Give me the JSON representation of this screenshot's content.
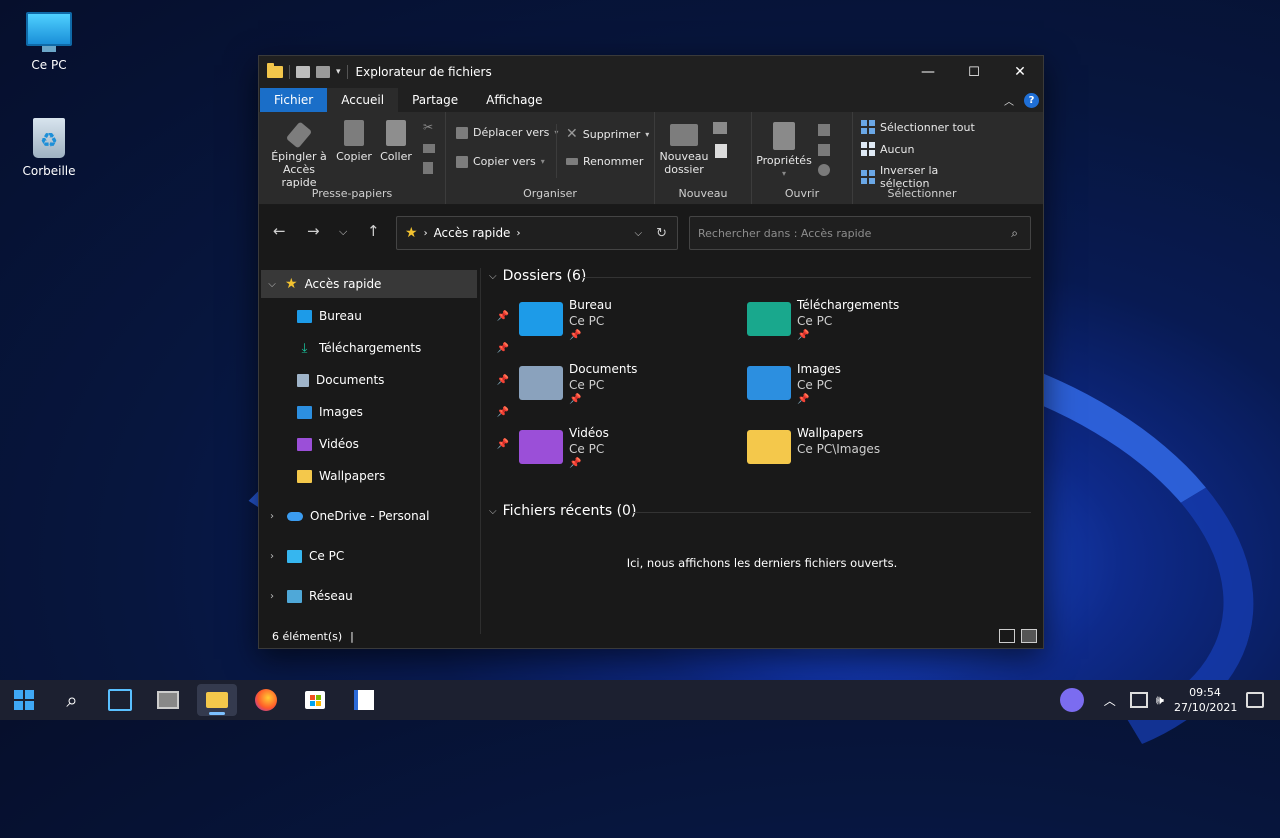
{
  "desktop": {
    "icons": [
      {
        "label": "Ce PC"
      },
      {
        "label": "Corbeille"
      }
    ]
  },
  "window": {
    "title": "Explorateur de fichiers",
    "controls": {
      "minimize": "—",
      "maximize": "☐",
      "close": "✕"
    },
    "tabs": {
      "file": "Fichier",
      "home": "Accueil",
      "share": "Partage",
      "view": "Affichage"
    },
    "help": "?"
  },
  "ribbon": {
    "clipboard": {
      "label": "Presse-papiers",
      "pin_line1": "Épingler à",
      "pin_line2": "Accès rapide",
      "copy": "Copier",
      "paste": "Coller"
    },
    "organize": {
      "label": "Organiser",
      "move_to": "Déplacer vers",
      "copy_to": "Copier vers",
      "delete": "Supprimer",
      "rename": "Renommer"
    },
    "new": {
      "label": "Nouveau",
      "new_folder_line1": "Nouveau",
      "new_folder_line2": "dossier"
    },
    "open": {
      "label": "Ouvrir",
      "properties": "Propriétés"
    },
    "select": {
      "label": "Sélectionner",
      "select_all": "Sélectionner tout",
      "none": "Aucun",
      "invert": "Inverser la sélection"
    }
  },
  "address": {
    "path": "Accès rapide",
    "search_placeholder": "Rechercher dans : Accès rapide"
  },
  "navpane": {
    "quick_access": "Accès rapide",
    "items": [
      {
        "label": "Bureau"
      },
      {
        "label": "Téléchargements"
      },
      {
        "label": "Documents"
      },
      {
        "label": "Images"
      },
      {
        "label": "Vidéos"
      },
      {
        "label": "Wallpapers"
      }
    ],
    "onedrive": "OneDrive - Personal",
    "this_pc": "Ce PC",
    "network": "Réseau"
  },
  "content": {
    "folders_header": "Dossiers (6)",
    "folders": [
      {
        "name": "Bureau",
        "location": "Ce PC",
        "color": "#1d9be8"
      },
      {
        "name": "Téléchargements",
        "location": "Ce PC",
        "color": "#19a88d"
      },
      {
        "name": "Documents",
        "location": "Ce PC",
        "color": "#8aa2bd"
      },
      {
        "name": "Images",
        "location": "Ce PC",
        "color": "#2c8fe0"
      },
      {
        "name": "Vidéos",
        "location": "Ce PC",
        "color": "#9b4fd8"
      },
      {
        "name": "Wallpapers",
        "location": "Ce PC\\Images",
        "color": "#f4c84b"
      }
    ],
    "recent_header": "Fichiers récents (0)",
    "recent_empty": "Ici, nous affichons les derniers fichiers ouverts."
  },
  "statusbar": {
    "count": "6 élément(s)",
    "separator": "|"
  },
  "taskbar": {
    "time": "09:54",
    "date": "27/10/2021"
  }
}
